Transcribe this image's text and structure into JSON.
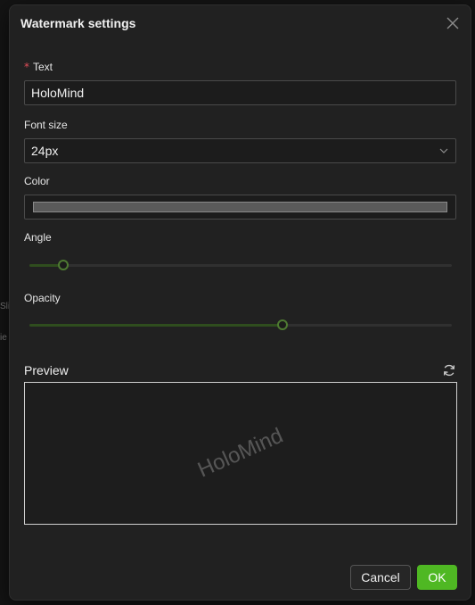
{
  "background": {
    "fragments": [
      "Sli",
      "ie"
    ]
  },
  "dialog": {
    "title": "Watermark settings",
    "close_icon": "close-icon"
  },
  "form": {
    "text": {
      "label": "Text",
      "required_mark": "*",
      "value": "HoloMind"
    },
    "font_size": {
      "label": "Font size",
      "value": "24px",
      "icon": "chevron-down-icon"
    },
    "color": {
      "label": "Color",
      "value": "#5a5a5a"
    },
    "angle": {
      "label": "Angle",
      "value_fraction": 0.08
    },
    "opacity": {
      "label": "Opacity",
      "value_fraction": 0.6
    }
  },
  "preview": {
    "label": "Preview",
    "refresh_icon": "refresh-icon",
    "watermark_text": "HoloMind"
  },
  "footer": {
    "cancel_label": "Cancel",
    "ok_label": "OK"
  },
  "colors": {
    "accent": "#4fb823",
    "slider_track": "#2f4d1e",
    "slider_handle": "#4e7a32",
    "required": "#e34d59"
  }
}
